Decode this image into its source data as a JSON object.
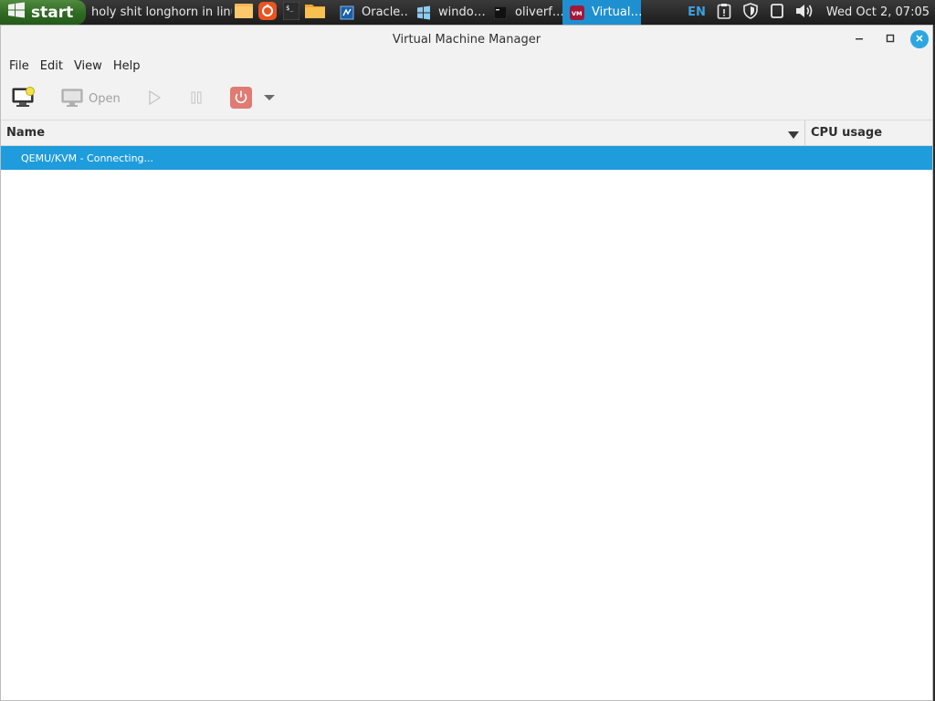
{
  "taskbar": {
    "start_label": "start",
    "tasks": [
      {
        "label": "holy shit longhorn in linux",
        "icon": "folder-icon"
      },
      {
        "label": "Oracle…",
        "icon": "virtualbox-icon"
      },
      {
        "label": "windo…",
        "icon": "windows-icon"
      },
      {
        "label": "oliverf…",
        "icon": "terminal-icon"
      },
      {
        "label": "Virtual…",
        "icon": "virt-manager-icon",
        "active": true
      }
    ],
    "quick_launch": [
      "folder-icon",
      "ubuntu-icon",
      "terminal-icon",
      "folder-icon"
    ],
    "tray": {
      "language": "EN",
      "clock": "Wed Oct  2, 07:05"
    }
  },
  "window": {
    "title": "Virtual Machine Manager",
    "menu": [
      "File",
      "Edit",
      "View",
      "Help"
    ],
    "toolbar": {
      "open_label": "Open"
    },
    "columns": {
      "name": "Name",
      "cpu": "CPU usage"
    },
    "rows": [
      {
        "label": "QEMU/KVM - Connecting..."
      }
    ]
  },
  "colors": {
    "accent": "#1e9cdc",
    "taskbar_active": "#1e90d0",
    "start_green": "#2f6a22",
    "power_red": "#e07a72"
  }
}
